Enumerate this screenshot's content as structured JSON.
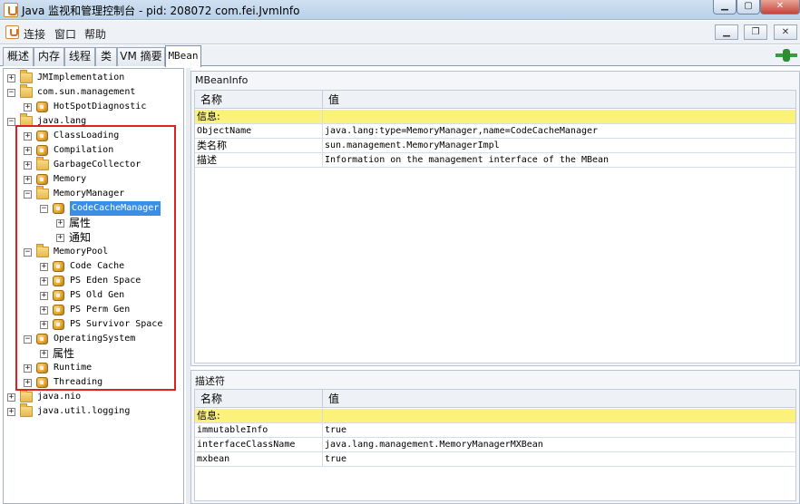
{
  "window": {
    "title": "Java 监视和管理控制台 - pid: 208072 com.fei.JvmInfo"
  },
  "menu": {
    "items": [
      "连接",
      "窗口",
      "帮助"
    ]
  },
  "tabs": [
    "概述",
    "内存",
    "线程",
    "类",
    "VM 摘要",
    "MBean"
  ],
  "tree": {
    "nodes": [
      {
        "label": "JMImplementation",
        "icon": "folder-icon"
      },
      {
        "label": "com.sun.management",
        "icon": "folder-icon"
      },
      {
        "label": "HotSpotDiagnostic",
        "icon": "bean-icon"
      },
      {
        "label": "java.lang",
        "icon": "folder-icon"
      },
      {
        "label": "ClassLoading",
        "icon": "bean-icon"
      },
      {
        "label": "Compilation",
        "icon": "bean-icon"
      },
      {
        "label": "GarbageCollector",
        "icon": "folder-icon"
      },
      {
        "label": "Memory",
        "icon": "bean-icon"
      },
      {
        "label": "MemoryManager",
        "icon": "folder-icon"
      },
      {
        "label": "CodeCacheManager",
        "icon": "bean-icon"
      },
      {
        "label": "属性",
        "icon": "none"
      },
      {
        "label": "通知",
        "icon": "none"
      },
      {
        "label": "MemoryPool",
        "icon": "folder-icon"
      },
      {
        "label": "Code Cache",
        "icon": "bean-icon"
      },
      {
        "label": "PS Eden Space",
        "icon": "bean-icon"
      },
      {
        "label": "PS Old Gen",
        "icon": "bean-icon"
      },
      {
        "label": "PS Perm Gen",
        "icon": "bean-icon"
      },
      {
        "label": "PS Survivor Space",
        "icon": "bean-icon"
      },
      {
        "label": "OperatingSystem",
        "icon": "bean-icon"
      },
      {
        "label": "属性",
        "icon": "none"
      },
      {
        "label": "Runtime",
        "icon": "bean-icon"
      },
      {
        "label": "Threading",
        "icon": "bean-icon"
      },
      {
        "label": "java.nio",
        "icon": "folder-icon"
      },
      {
        "label": "java.util.logging",
        "icon": "folder-icon"
      }
    ]
  },
  "mbean_info": {
    "title": "MBeanInfo",
    "headers": [
      "名称",
      "值"
    ],
    "group": "信息:",
    "rows": [
      [
        "ObjectName",
        "java.lang:type=MemoryManager,name=CodeCacheManager"
      ],
      [
        "类名称",
        "sun.management.MemoryManagerImpl"
      ],
      [
        "描述",
        "Information on the management interface of the MBean"
      ]
    ]
  },
  "descriptor": {
    "title": "描述符",
    "headers": [
      "名称",
      "值"
    ],
    "group": "信息:",
    "rows": [
      [
        "immutableInfo",
        "true"
      ],
      [
        "interfaceClassName",
        "java.lang.management.MemoryManagerMXBean"
      ],
      [
        "mxbean",
        "true"
      ]
    ]
  },
  "colors": {
    "selection": "#3a8ee6",
    "group_row": "#fbf27c",
    "highlight_box": "#e02020"
  }
}
